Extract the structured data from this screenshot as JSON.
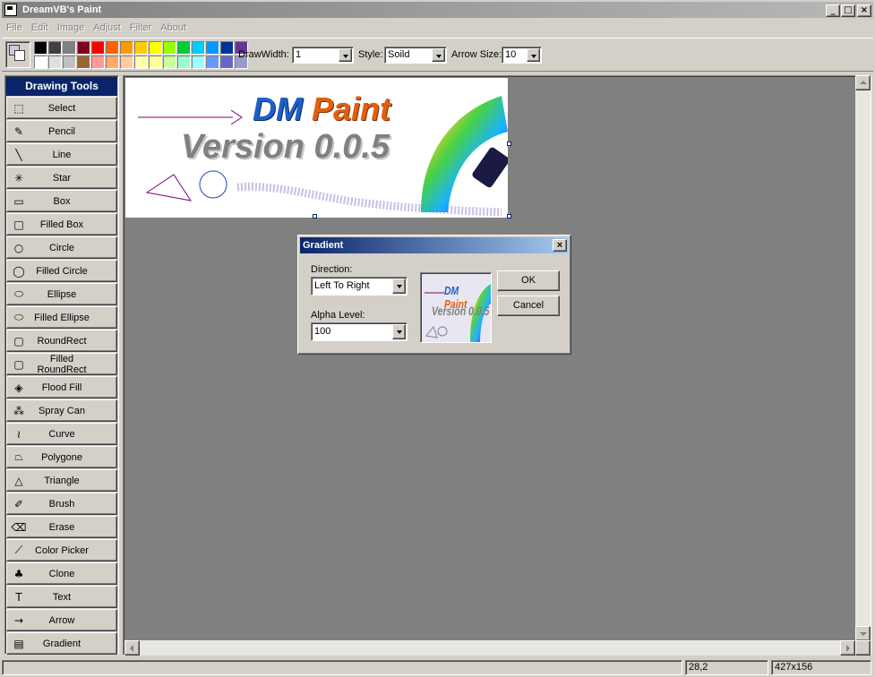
{
  "window": {
    "title": "DreamVB's Paint"
  },
  "menu": [
    "File",
    "Edit",
    "Image",
    "Adjust",
    "Filter",
    "About"
  ],
  "toolbar": {
    "palette": [
      "#000000",
      "#404040",
      "#808080",
      "#800020",
      "#ff0000",
      "#ff6000",
      "#ff9900",
      "#ffcc00",
      "#ffff00",
      "#99ff00",
      "#00cc33",
      "#00ccff",
      "#0099ff",
      "#003399",
      "#663399",
      "#ffffff",
      "#e0e0e0",
      "#c0c0c0",
      "#996633",
      "#ff9999",
      "#ffaa66",
      "#ffcc99",
      "#ffffaa",
      "#ffff99",
      "#ccff99",
      "#99ffcc",
      "#99ffff",
      "#6699ff",
      "#6666cc",
      "#9999cc"
    ],
    "drawwidth_label": "DrawWidth:",
    "drawwidth_value": "1",
    "style_label": "Style:",
    "style_value": "Soild",
    "arrowsize_label": "Arrow Size:",
    "arrowsize_value": "10"
  },
  "tools": {
    "header": "Drawing Tools",
    "items": [
      {
        "label": "Select",
        "icon": "select-icon",
        "glyph": "⬚"
      },
      {
        "label": "Pencil",
        "icon": "pencil-icon",
        "glyph": "✎"
      },
      {
        "label": "Line",
        "icon": "line-icon",
        "glyph": "╲"
      },
      {
        "label": "Star",
        "icon": "star-icon",
        "glyph": "✳"
      },
      {
        "label": "Box",
        "icon": "box-icon",
        "glyph": "▭"
      },
      {
        "label": "Filled Box",
        "icon": "filled-box-icon",
        "glyph": "□"
      },
      {
        "label": "Circle",
        "icon": "circle-icon",
        "glyph": "○"
      },
      {
        "label": "Filled Circle",
        "icon": "filled-circle-icon",
        "glyph": "◯"
      },
      {
        "label": "Ellipse",
        "icon": "ellipse-icon",
        "glyph": "⬭"
      },
      {
        "label": "Filled Ellipse",
        "icon": "filled-ellipse-icon",
        "glyph": "⬭"
      },
      {
        "label": "RoundRect",
        "icon": "roundrect-icon",
        "glyph": "▢"
      },
      {
        "label": "Filled RoundRect",
        "icon": "filled-roundrect-icon",
        "glyph": "▢"
      },
      {
        "label": "Flood Fill",
        "icon": "flood-fill-icon",
        "glyph": "◈"
      },
      {
        "label": "Spray Can",
        "icon": "spray-can-icon",
        "glyph": "⁂"
      },
      {
        "label": "Curve",
        "icon": "curve-icon",
        "glyph": "≀"
      },
      {
        "label": "Polygone",
        "icon": "polygon-icon",
        "glyph": "⏢"
      },
      {
        "label": "Triangle",
        "icon": "triangle-icon",
        "glyph": "△"
      },
      {
        "label": "Brush",
        "icon": "brush-icon",
        "glyph": "✐"
      },
      {
        "label": "Erase",
        "icon": "eraser-icon",
        "glyph": "⌫"
      },
      {
        "label": "Color Picker",
        "icon": "color-picker-icon",
        "glyph": "⟋"
      },
      {
        "label": "Clone",
        "icon": "clone-icon",
        "glyph": "♣"
      },
      {
        "label": "Text",
        "icon": "text-icon",
        "glyph": "T"
      },
      {
        "label": "Arrow",
        "icon": "arrow-icon",
        "glyph": "→"
      },
      {
        "label": "Gradient",
        "icon": "gradient-icon",
        "glyph": "▤"
      }
    ]
  },
  "canvas": {
    "line1": "DM",
    "line1b": "Paint",
    "line2": "Version 0.0.5"
  },
  "dialog": {
    "title": "Gradient",
    "close": "×",
    "direction_label": "Direction:",
    "direction_value": "Left To Right",
    "alpha_label": "Alpha Level:",
    "alpha_value": "100",
    "ok": "OK",
    "cancel": "Cancel",
    "preview_line1": "DM",
    "preview_line1b": "Paint",
    "preview_line2": "Version 0.0.5"
  },
  "status": {
    "coords": "28,2",
    "size": "427x156"
  }
}
